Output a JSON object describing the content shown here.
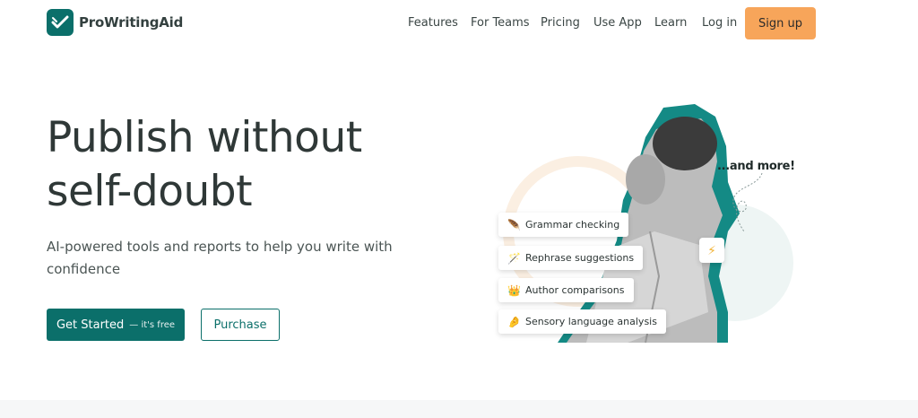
{
  "brand": {
    "name": "ProWritingAid",
    "accent": "#0b6f6a",
    "cta_color": "#f7a55a"
  },
  "nav": {
    "items": [
      "Features",
      "For Teams",
      "Pricing",
      "Use App",
      "Learn",
      "Log in"
    ],
    "signup": "Sign up"
  },
  "hero": {
    "title_line1": "Publish without",
    "title_line2": "self-doubt",
    "subtitle": "AI-powered tools and reports to help you write with confidence",
    "primary_cta": "Get Started",
    "primary_cta_note": "— it's free",
    "secondary_cta": "Purchase"
  },
  "illustration": {
    "features": [
      {
        "label": "Grammar checking",
        "icon": "quill-icon"
      },
      {
        "label": "Rephrase suggestions",
        "icon": "magic-wand-icon"
      },
      {
        "label": "Author comparisons",
        "icon": "crown-icon"
      },
      {
        "label": "Sensory language analysis",
        "icon": "hand-icon"
      }
    ],
    "more_label": "...and more!",
    "bolt_icon": "lightning-icon"
  }
}
